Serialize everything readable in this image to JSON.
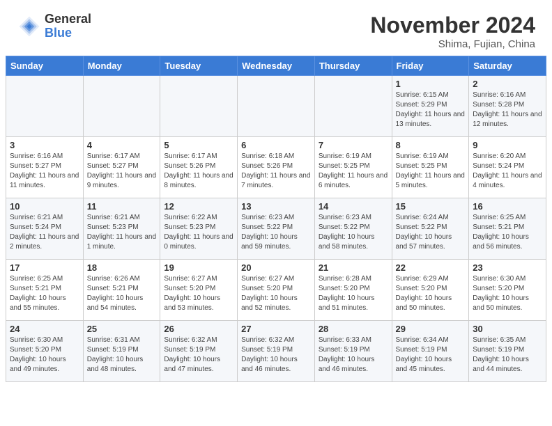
{
  "logo": {
    "general": "General",
    "blue": "Blue"
  },
  "header": {
    "month": "November 2024",
    "location": "Shima, Fujian, China"
  },
  "weekdays": [
    "Sunday",
    "Monday",
    "Tuesday",
    "Wednesday",
    "Thursday",
    "Friday",
    "Saturday"
  ],
  "weeks": [
    [
      {
        "day": "",
        "info": ""
      },
      {
        "day": "",
        "info": ""
      },
      {
        "day": "",
        "info": ""
      },
      {
        "day": "",
        "info": ""
      },
      {
        "day": "",
        "info": ""
      },
      {
        "day": "1",
        "info": "Sunrise: 6:15 AM\nSunset: 5:29 PM\nDaylight: 11 hours and 13 minutes."
      },
      {
        "day": "2",
        "info": "Sunrise: 6:16 AM\nSunset: 5:28 PM\nDaylight: 11 hours and 12 minutes."
      }
    ],
    [
      {
        "day": "3",
        "info": "Sunrise: 6:16 AM\nSunset: 5:27 PM\nDaylight: 11 hours and 11 minutes."
      },
      {
        "day": "4",
        "info": "Sunrise: 6:17 AM\nSunset: 5:27 PM\nDaylight: 11 hours and 9 minutes."
      },
      {
        "day": "5",
        "info": "Sunrise: 6:17 AM\nSunset: 5:26 PM\nDaylight: 11 hours and 8 minutes."
      },
      {
        "day": "6",
        "info": "Sunrise: 6:18 AM\nSunset: 5:26 PM\nDaylight: 11 hours and 7 minutes."
      },
      {
        "day": "7",
        "info": "Sunrise: 6:19 AM\nSunset: 5:25 PM\nDaylight: 11 hours and 6 minutes."
      },
      {
        "day": "8",
        "info": "Sunrise: 6:19 AM\nSunset: 5:25 PM\nDaylight: 11 hours and 5 minutes."
      },
      {
        "day": "9",
        "info": "Sunrise: 6:20 AM\nSunset: 5:24 PM\nDaylight: 11 hours and 4 minutes."
      }
    ],
    [
      {
        "day": "10",
        "info": "Sunrise: 6:21 AM\nSunset: 5:24 PM\nDaylight: 11 hours and 2 minutes."
      },
      {
        "day": "11",
        "info": "Sunrise: 6:21 AM\nSunset: 5:23 PM\nDaylight: 11 hours and 1 minute."
      },
      {
        "day": "12",
        "info": "Sunrise: 6:22 AM\nSunset: 5:23 PM\nDaylight: 11 hours and 0 minutes."
      },
      {
        "day": "13",
        "info": "Sunrise: 6:23 AM\nSunset: 5:22 PM\nDaylight: 10 hours and 59 minutes."
      },
      {
        "day": "14",
        "info": "Sunrise: 6:23 AM\nSunset: 5:22 PM\nDaylight: 10 hours and 58 minutes."
      },
      {
        "day": "15",
        "info": "Sunrise: 6:24 AM\nSunset: 5:22 PM\nDaylight: 10 hours and 57 minutes."
      },
      {
        "day": "16",
        "info": "Sunrise: 6:25 AM\nSunset: 5:21 PM\nDaylight: 10 hours and 56 minutes."
      }
    ],
    [
      {
        "day": "17",
        "info": "Sunrise: 6:25 AM\nSunset: 5:21 PM\nDaylight: 10 hours and 55 minutes."
      },
      {
        "day": "18",
        "info": "Sunrise: 6:26 AM\nSunset: 5:21 PM\nDaylight: 10 hours and 54 minutes."
      },
      {
        "day": "19",
        "info": "Sunrise: 6:27 AM\nSunset: 5:20 PM\nDaylight: 10 hours and 53 minutes."
      },
      {
        "day": "20",
        "info": "Sunrise: 6:27 AM\nSunset: 5:20 PM\nDaylight: 10 hours and 52 minutes."
      },
      {
        "day": "21",
        "info": "Sunrise: 6:28 AM\nSunset: 5:20 PM\nDaylight: 10 hours and 51 minutes."
      },
      {
        "day": "22",
        "info": "Sunrise: 6:29 AM\nSunset: 5:20 PM\nDaylight: 10 hours and 50 minutes."
      },
      {
        "day": "23",
        "info": "Sunrise: 6:30 AM\nSunset: 5:20 PM\nDaylight: 10 hours and 50 minutes."
      }
    ],
    [
      {
        "day": "24",
        "info": "Sunrise: 6:30 AM\nSunset: 5:20 PM\nDaylight: 10 hours and 49 minutes."
      },
      {
        "day": "25",
        "info": "Sunrise: 6:31 AM\nSunset: 5:19 PM\nDaylight: 10 hours and 48 minutes."
      },
      {
        "day": "26",
        "info": "Sunrise: 6:32 AM\nSunset: 5:19 PM\nDaylight: 10 hours and 47 minutes."
      },
      {
        "day": "27",
        "info": "Sunrise: 6:32 AM\nSunset: 5:19 PM\nDaylight: 10 hours and 46 minutes."
      },
      {
        "day": "28",
        "info": "Sunrise: 6:33 AM\nSunset: 5:19 PM\nDaylight: 10 hours and 46 minutes."
      },
      {
        "day": "29",
        "info": "Sunrise: 6:34 AM\nSunset: 5:19 PM\nDaylight: 10 hours and 45 minutes."
      },
      {
        "day": "30",
        "info": "Sunrise: 6:35 AM\nSunset: 5:19 PM\nDaylight: 10 hours and 44 minutes."
      }
    ]
  ]
}
